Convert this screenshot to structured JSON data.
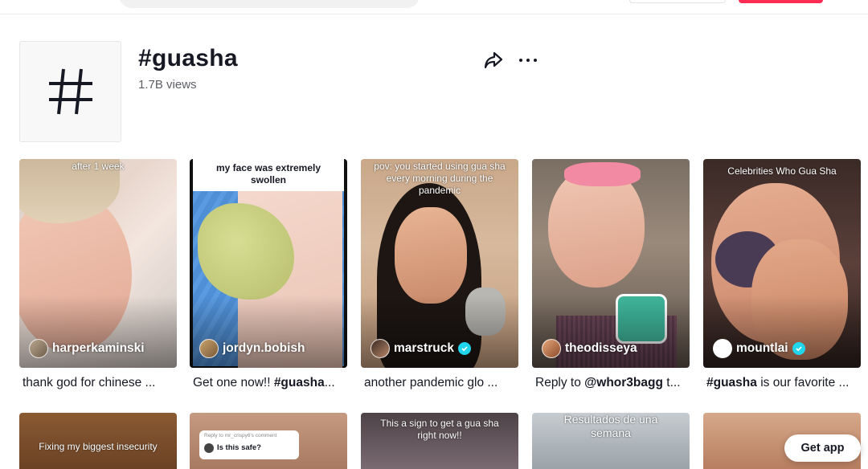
{
  "header": {
    "title": "#guasha",
    "views": "1.7B views"
  },
  "colors": {
    "brand": "#fe2c55",
    "verified": "#20d5ec"
  },
  "videos": [
    {
      "overlay": "after 1 week",
      "author": "harperkaminski",
      "verified": false,
      "caption": "thank god for chinese ..."
    },
    {
      "overlay": "my face was extremely swollen",
      "author": "jordyn.bobish",
      "verified": false,
      "caption_hashtag": "#guasha",
      "caption_prefix": "Get one now!! ",
      "caption_suffix": "..."
    },
    {
      "overlay": "pov: you started using gua sha every morning during the pandemic",
      "author": "marstruck",
      "verified": true,
      "caption": "another pandemic glo ..."
    },
    {
      "overlay": "",
      "author": "theodisseya",
      "verified": false,
      "caption_prefix": "Reply to ",
      "caption_hashtag": "@whor3bagg",
      "caption_suffix": " t..."
    },
    {
      "overlay": "Celebrities Who Gua Sha",
      "author": "mountlai",
      "verified": true,
      "caption_hashtag": "#guasha",
      "caption_suffix": " is our favorite ..."
    }
  ],
  "second_row": [
    {
      "overlay": "Fixing my biggest insecurity"
    },
    {
      "overlay_small": "Reply to mr_crispy6's comment",
      "overlay": "Is this safe?"
    },
    {
      "overlay": "This a sign to get a gua sha right now!!"
    },
    {
      "overlay": "Resultados de una semana"
    },
    {
      "overlay": ""
    }
  ],
  "get_app": "Get app"
}
